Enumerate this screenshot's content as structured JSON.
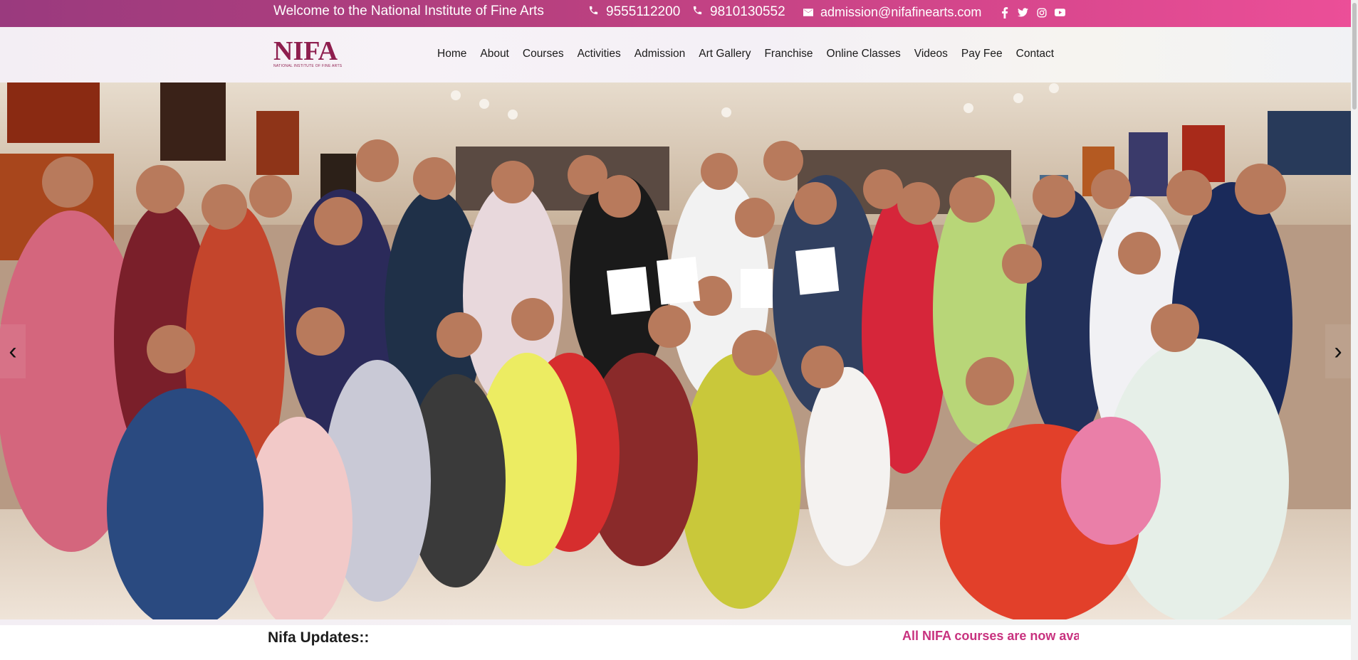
{
  "topbar": {
    "welcome": "Welcome to the National Institute of Fine Arts",
    "phone1": "9555112200",
    "phone2": "9810130552",
    "email": "admission@nifafinearts.com",
    "social_icons": [
      "facebook-icon",
      "twitter-icon",
      "instagram-icon",
      "youtube-icon"
    ]
  },
  "logo": {
    "text": "NIFA",
    "subtitle": "NATIONAL INSTITUTE OF FINE ARTS"
  },
  "nav": {
    "items": [
      {
        "label": "Home"
      },
      {
        "label": "About"
      },
      {
        "label": "Courses"
      },
      {
        "label": "Activities"
      },
      {
        "label": "Admission"
      },
      {
        "label": "Art Gallery"
      },
      {
        "label": "Franchise"
      },
      {
        "label": "Online Classes"
      },
      {
        "label": "Videos"
      },
      {
        "label": "Pay Fee"
      },
      {
        "label": "Contact"
      }
    ]
  },
  "hero": {
    "prev_icon": "‹",
    "next_icon": "›"
  },
  "updates": {
    "label": "Nifa Updates::",
    "ticker": "All NIFA courses are now ava"
  },
  "colors": {
    "topbar_start": "#9a3a7e",
    "topbar_end": "#ec4f98",
    "brand": "#8e1e4e",
    "ticker": "#c8327f"
  }
}
